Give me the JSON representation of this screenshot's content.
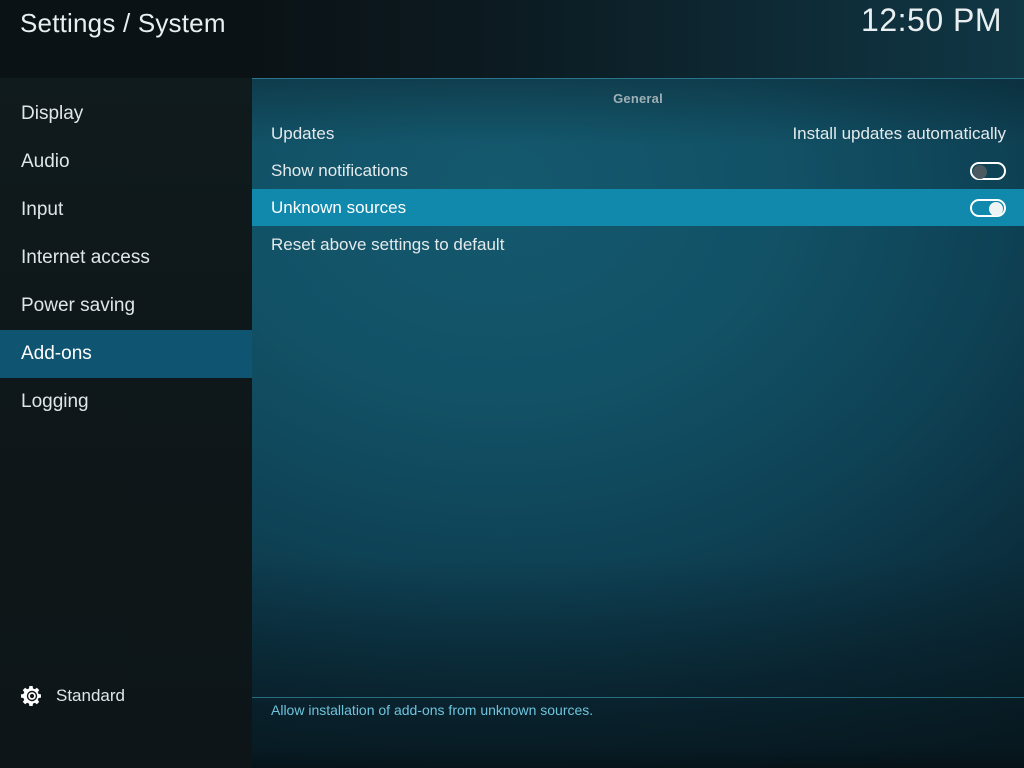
{
  "header": {
    "title": "Settings / System",
    "clock": "12:50 PM"
  },
  "sidebar": {
    "items": [
      {
        "label": "Display",
        "selected": false
      },
      {
        "label": "Audio",
        "selected": false
      },
      {
        "label": "Input",
        "selected": false
      },
      {
        "label": "Internet access",
        "selected": false
      },
      {
        "label": "Power saving",
        "selected": false
      },
      {
        "label": "Add-ons",
        "selected": true
      },
      {
        "label": "Logging",
        "selected": false
      }
    ],
    "profile": {
      "icon": "gear-icon",
      "label": "Standard"
    }
  },
  "main": {
    "section_header": "General",
    "rows": [
      {
        "label": "Updates",
        "control": "value",
        "value": "Install updates automatically",
        "selected": false
      },
      {
        "label": "Show notifications",
        "control": "toggle",
        "toggle_state": "off",
        "selected": false
      },
      {
        "label": "Unknown sources",
        "control": "toggle",
        "toggle_state": "on",
        "selected": true
      },
      {
        "label": "Reset above settings to default",
        "control": "none",
        "selected": false
      }
    ]
  },
  "help": {
    "text": "Allow installation of add-ons from unknown sources."
  },
  "colors": {
    "sidebar_highlight": "#0f5470",
    "row_highlight": "#1189ad",
    "rule": "#2f7f96",
    "help_text": "#6fc3dd",
    "text_primary": "#e4eaec"
  }
}
